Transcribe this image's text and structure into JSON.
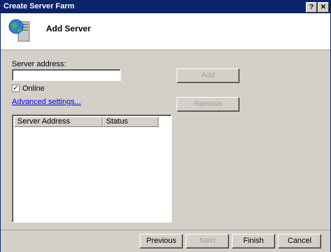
{
  "window": {
    "title": "Create Server Farm",
    "help_label": "?",
    "close_label": "✕"
  },
  "header": {
    "title": "Add Server",
    "icon": "server-globe-icon"
  },
  "form": {
    "server_address_label": "Server address:",
    "server_address_value": "",
    "online_label": "Online",
    "online_checked": true,
    "online_check_glyph": "✓",
    "advanced_link": "Advanced settings..."
  },
  "buttons": {
    "add": "Add",
    "remove": "Remove"
  },
  "list": {
    "columns": [
      "Server Address",
      "Status"
    ],
    "rows": []
  },
  "footer": {
    "previous": "Previous",
    "next": "Next",
    "finish": "Finish",
    "cancel": "Cancel"
  }
}
